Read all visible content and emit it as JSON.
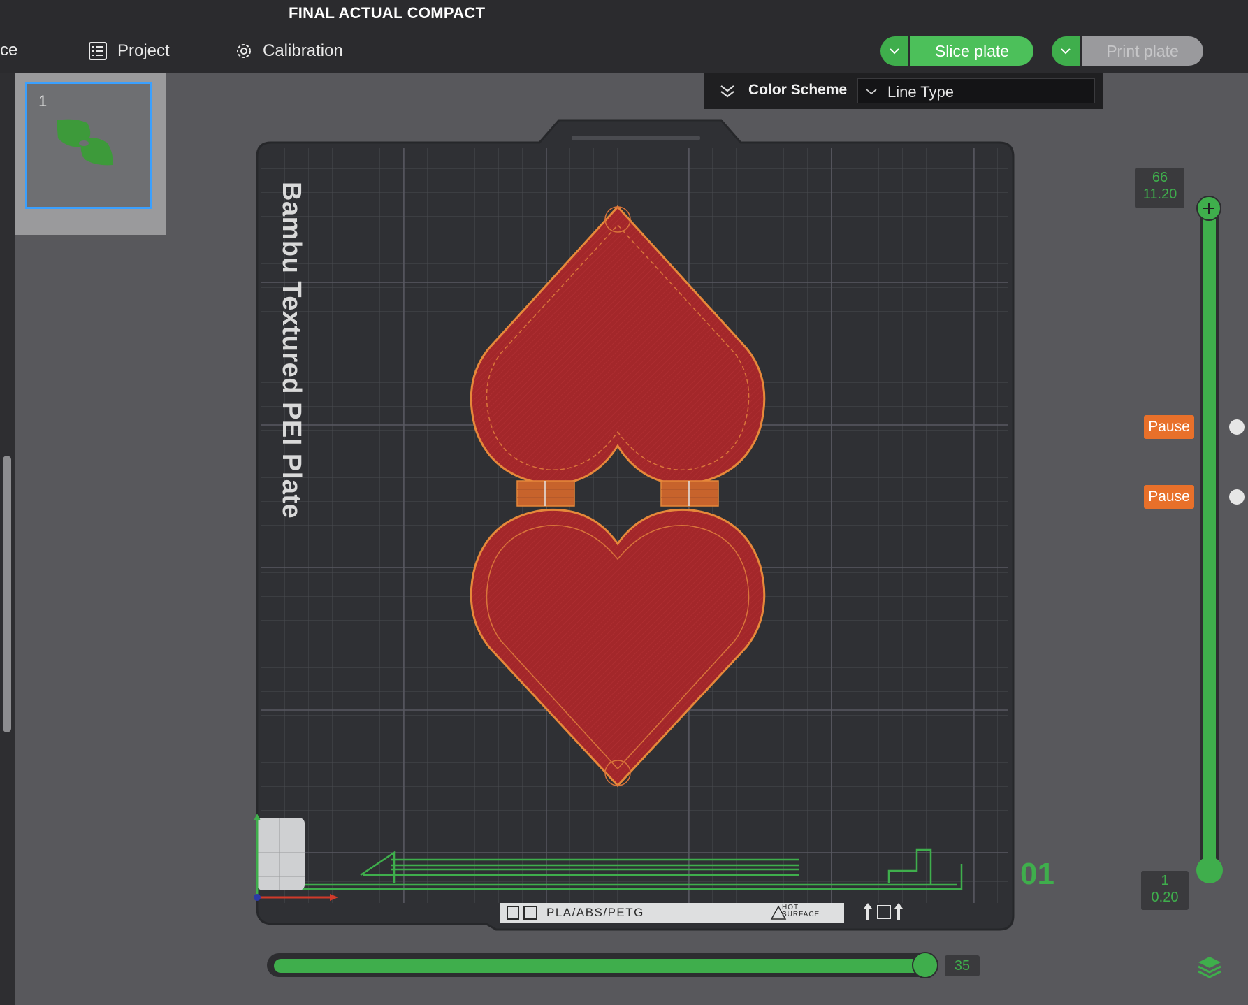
{
  "app": {
    "title": "FINAL ACTUAL COMPACT"
  },
  "tabs": [
    {
      "label": "ce",
      "icon": ""
    },
    {
      "label": "Project",
      "icon": "list-icon"
    },
    {
      "label": "Calibration",
      "icon": "gear-icon"
    }
  ],
  "toolbar": {
    "slice_label": "Slice plate",
    "print_label": "Print plate"
  },
  "thumbnail": {
    "number": "1"
  },
  "color_scheme": {
    "label": "Color Scheme",
    "value": "Line Type"
  },
  "plate": {
    "name": "Bambu Textured PEI Plate",
    "number": "01",
    "footer_material": "PLA/ABS/PETG",
    "hot_line1": "HOT",
    "hot_line2": "SURFACE"
  },
  "layer_slider": {
    "top_layer": "66",
    "top_height": "11.20",
    "bottom_layer": "1",
    "bottom_height": "0.20",
    "pauses": [
      "Pause",
      "Pause"
    ]
  },
  "move_slider": {
    "value": "35"
  },
  "colors": {
    "accent": "#3fae4c",
    "pause": "#e8702a",
    "model": "#a3272a",
    "selection": "#3aa0ff"
  }
}
